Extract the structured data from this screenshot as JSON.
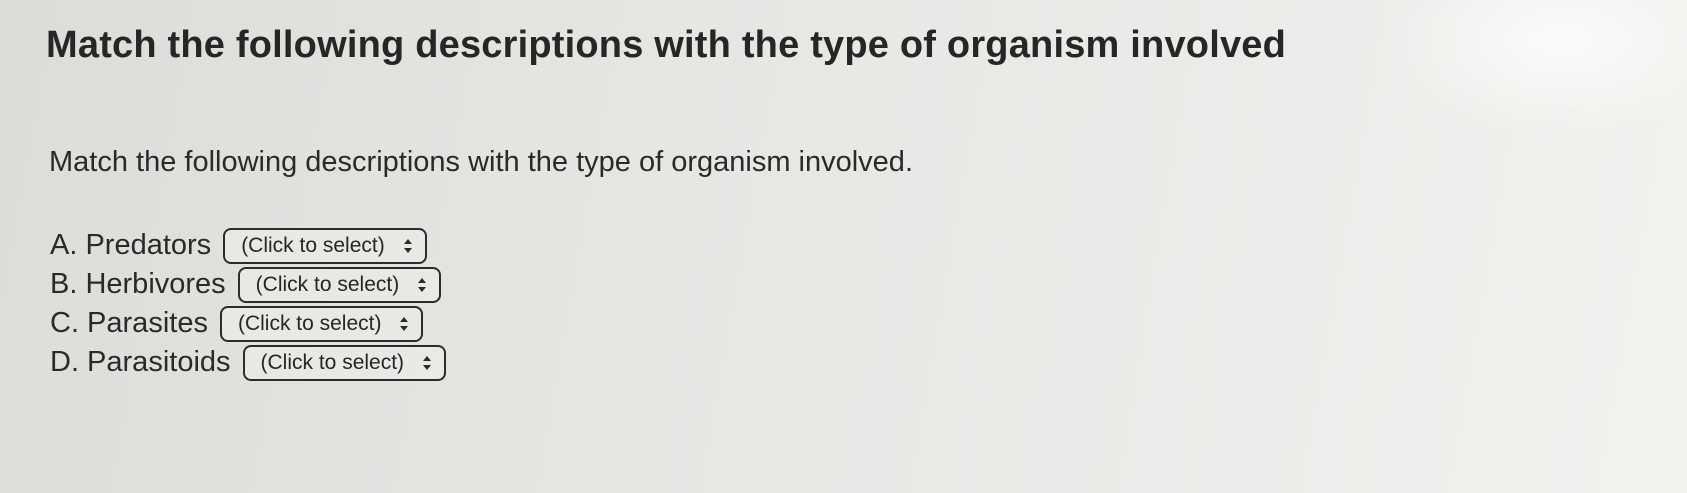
{
  "question": {
    "title": "Match the following descriptions with the type of organism involved",
    "prompt": "Match the following descriptions with the type of organism involved."
  },
  "matches": [
    {
      "label": "A. Predators",
      "selected": "(Click to select)"
    },
    {
      "label": "B. Herbivores",
      "selected": "(Click to select)"
    },
    {
      "label": "C. Parasites",
      "selected": "(Click to select)"
    },
    {
      "label": "D. Parasitoids",
      "selected": "(Click to select)"
    }
  ],
  "icons": {
    "select_arrows": "updown-chevron-icon"
  }
}
